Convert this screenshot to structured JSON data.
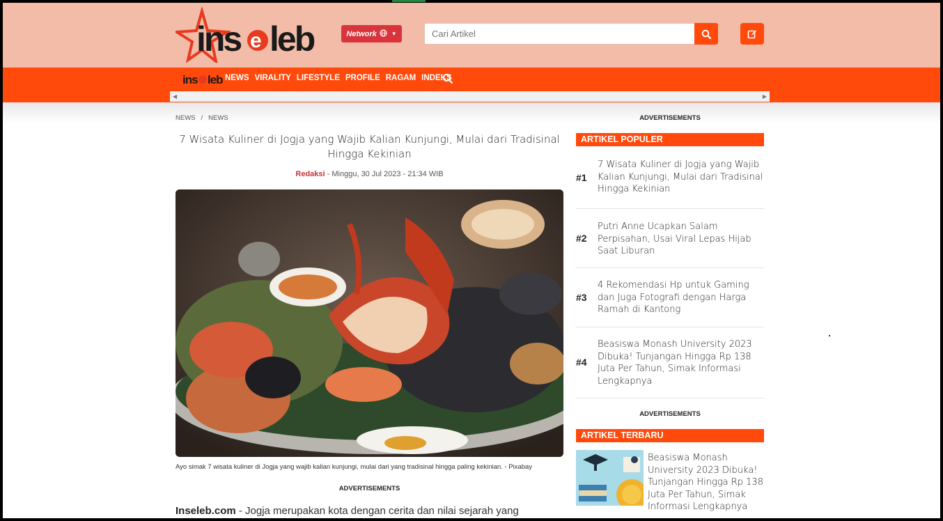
{
  "header": {
    "logo_text": "inseleb",
    "network_label": "Network",
    "search_placeholder": "Cari Artikel"
  },
  "nav": {
    "logo_text": "inseleb",
    "items": [
      "NEWS",
      "VIRALITY",
      "LIFESTYLE",
      "PROFILE",
      "RAGAM",
      "INDEKS"
    ]
  },
  "breadcrumb": [
    "NEWS",
    "/",
    "NEWS"
  ],
  "article": {
    "title": "7 Wisata Kuliner di Jogja yang Wajib Kalian Kunjungi, Mulai dari Tradisinal Hingga Kekinian",
    "author": "Redaksi",
    "date": "- Minggu, 30 Jul 2023 - 21:34 WIB",
    "caption": "Ayo simak 7 wisata kuliner di Jogja yang wajib kalian kunjungi, mulai dari yang tradisinal hingga paling kekinian. - Pixabay",
    "ads_label": "ADVERTISEMENTS",
    "lead_brand": "Inseleb.com",
    "lead_text": " - Jogja merupakan kota dengan cerita dan nilai sejarah yang"
  },
  "sidebar": {
    "ads_label_1": "ADVERTISEMENTS",
    "popular_heading": "ARTIKEL POPULER",
    "popular": [
      {
        "rank": "#1",
        "title": "7 Wisata Kuliner di Jogja yang Wajib Kalian Kunjungi, Mulai dari Tradisinal Hingga Kekinian"
      },
      {
        "rank": "#2",
        "title": "Putri Anne Ucapkan Salam Perpisahan, Usai Viral Lepas Hijab Saat Liburan"
      },
      {
        "rank": "#3",
        "title": "4 Rekomendasi Hp untuk Gaming dan Juga Fotografi dengan Harga Ramah di Kantong"
      },
      {
        "rank": "#4",
        "title": "Beasiswa Monash University 2023 Dibuka! Tunjangan Hingga Rp 138 Juta Per Tahun, Simak Informasi Lengkapnya"
      }
    ],
    "ads_label_2": "ADVERTISEMENTS",
    "latest_heading": "ARTIKEL TERBARU",
    "latest": {
      "title": "Beasiswa Monash University 2023 Dibuka! Tunjangan Hingga Rp 138 Juta Per Tahun, Simak Informasi Lengkapnya"
    }
  },
  "colors": {
    "brand_orange": "#ff4a0c",
    "header_bg": "#f2bca8",
    "network_red": "#d9343b"
  }
}
